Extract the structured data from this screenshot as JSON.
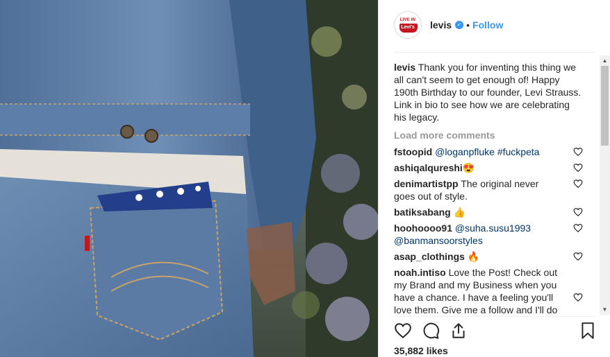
{
  "post": {
    "username": "levis",
    "verified": true,
    "separator": "•",
    "follow_label": "Follow",
    "avatar": {
      "logo_top": "LIVE IN",
      "logo_name": "Levi's",
      "brand_color": "#c4161c"
    },
    "caption": {
      "username": "levis",
      "text": "Thank you for inventing this thing we all can't seem to get enough of! Happy 190th Birthday to our founder, Levi Strauss. Link in bio to see how we are celebrating his legacy."
    },
    "load_more_label": "Load more comments",
    "likes_text": "35,882 likes"
  },
  "comments": [
    {
      "username": "fstoopid",
      "mention": "@loganpfluke #fuckpeta",
      "text": "",
      "emoji": ""
    },
    {
      "username": "ashiqalqureshi",
      "mention": "",
      "text": "",
      "emoji": "😍"
    },
    {
      "username": "denimartistpp",
      "mention": "",
      "text": "The original never goes out of style.",
      "emoji": ""
    },
    {
      "username": "batiksabang",
      "mention": "",
      "text": "",
      "emoji": "👍"
    },
    {
      "username": "hoohoooo91",
      "mention": "@suha.susu1993 @banmansoorstyles",
      "text": "",
      "emoji": ""
    },
    {
      "username": "asap_clothings",
      "mention": "",
      "text": "",
      "emoji": "🔥"
    },
    {
      "username": "noah.intiso",
      "mention": "",
      "text": "Love the Post! Check out my Brand and my Business when you have a chance. I have a feeling you'll love them. Give me a follow and I'll do",
      "emoji": ""
    }
  ],
  "icons": {
    "heart": "heart-icon",
    "comment": "comment-icon",
    "share": "share-icon",
    "save": "bookmark-icon",
    "verified": "verified-badge-icon"
  },
  "colors": {
    "link_blue": "#3897f0",
    "mention_blue": "#003569",
    "muted": "#999999"
  }
}
